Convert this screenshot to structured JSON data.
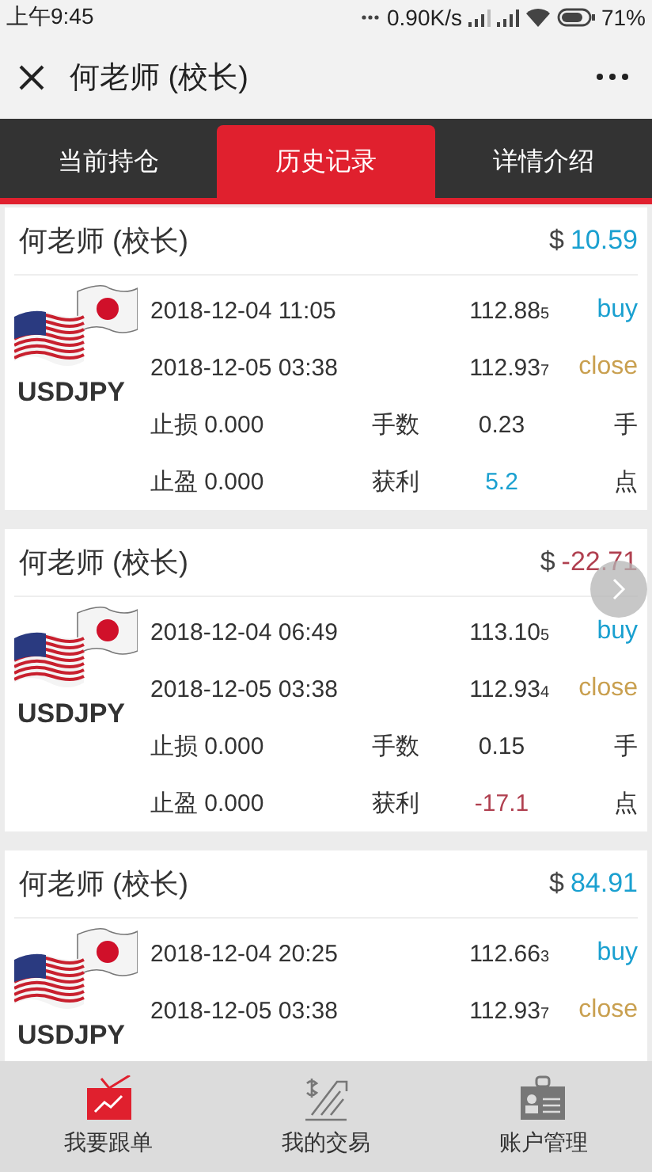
{
  "status_bar": {
    "time": "上午9:45",
    "speed": "0.90K/s",
    "battery": "71%"
  },
  "header": {
    "title": "何老师 (校长)"
  },
  "tabs": [
    {
      "label": "当前持仓",
      "selected": false
    },
    {
      "label": "历史记录",
      "selected": true
    },
    {
      "label": "详情介绍",
      "selected": false
    }
  ],
  "records": [
    {
      "trader": "何老师 (校长)",
      "currency": "$",
      "amount": "10.59",
      "negative": false,
      "symbol": "USDJPY",
      "trades": [
        {
          "time": "2018-12-04 11:05",
          "price": "112.88$_{5}$",
          "side": "buy",
          "kind": "open"
        },
        {
          "time": "2018-12-05 03:38",
          "price": "112.93$_{7}$",
          "side": "close",
          "kind": "close"
        }
      ],
      "stop_loss": "止损 0.000",
      "take_profit": "止盈 0.000",
      "lots_label": "手数",
      "lots": "0.23",
      "lots_unit": "手",
      "profit_label": "获利",
      "profit": "5.2",
      "profit_unit": "点"
    },
    {
      "trader": "何老师 (校长)",
      "currency": "$",
      "amount": "-22.71",
      "negative": true,
      "symbol": "USDJPY",
      "trades": [
        {
          "time": "2018-12-04 06:49",
          "price": "113.10$_{5}$",
          "side": "buy",
          "kind": "open"
        },
        {
          "time": "2018-12-05 03:38",
          "price": "112.93$_{4}$",
          "side": "close",
          "kind": "close"
        }
      ],
      "stop_loss": "止损 0.000",
      "take_profit": "止盈 0.000",
      "lots_label": "手数",
      "lots": "0.15",
      "lots_unit": "手",
      "profit_label": "获利",
      "profit": "-17.1",
      "profit_unit": "点"
    },
    {
      "trader": "何老师 (校长)",
      "currency": "$",
      "amount": "84.91",
      "negative": false,
      "symbol": "USDJPY",
      "trades": [
        {
          "time": "2018-12-04 20:25",
          "price": "112.66$_{3}$",
          "side": "buy",
          "kind": "open"
        },
        {
          "time": "2018-12-05 03:38",
          "price": "112.93$_{7}$",
          "side": "close",
          "kind": "close"
        }
      ]
    }
  ],
  "bottom_nav": [
    {
      "label": "我要跟单",
      "selected": true,
      "kind": "follow"
    },
    {
      "label": "我的交易",
      "selected": false,
      "kind": "trades"
    },
    {
      "label": "账户管理",
      "selected": false,
      "kind": "account"
    }
  ]
}
